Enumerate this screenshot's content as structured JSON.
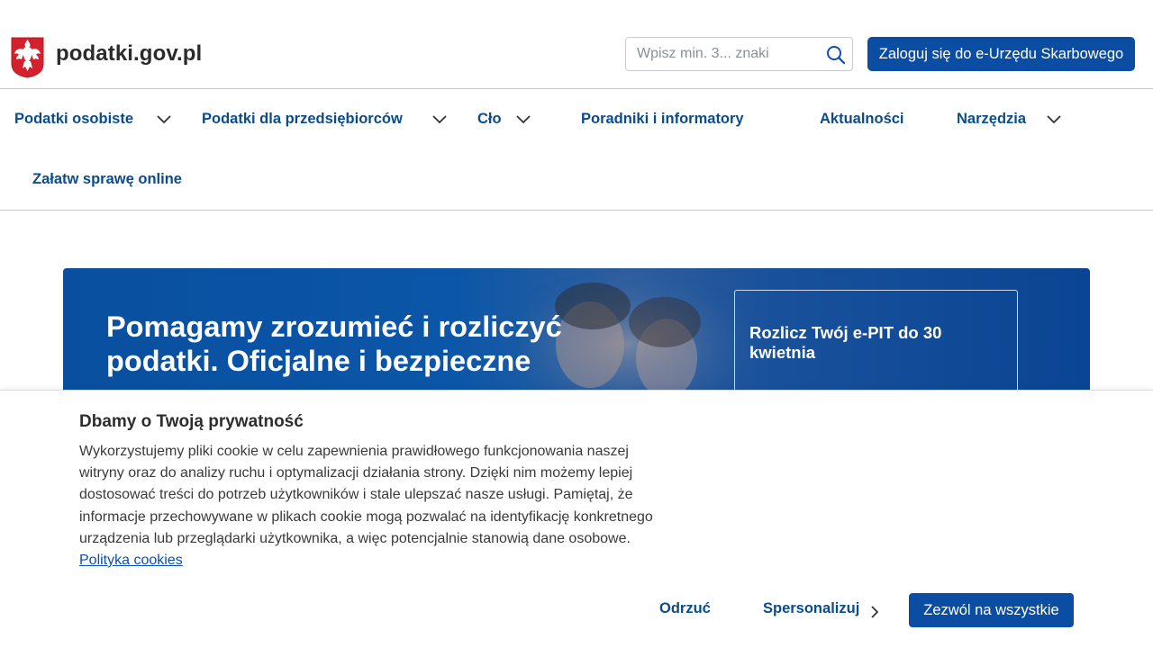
{
  "header": {
    "site_name": "podatki.gov.pl",
    "search_placeholder": "Wpisz min. 3... znaki",
    "login_label": "Zaloguj się do e-Urzędu Skarbowego"
  },
  "nav": {
    "items": [
      {
        "label": "Podatki osobiste",
        "has_dropdown": true
      },
      {
        "label": "Podatki dla przedsiębiorców",
        "has_dropdown": true
      },
      {
        "label": "Cło",
        "has_dropdown": true
      },
      {
        "label": "Poradniki i informatory",
        "has_dropdown": false
      },
      {
        "label": "Aktualności",
        "has_dropdown": false
      },
      {
        "label": "Narzędzia",
        "has_dropdown": true
      },
      {
        "label": "Załatw sprawę online",
        "has_dropdown": false
      }
    ]
  },
  "hero": {
    "title": "Pomagamy zrozumieć i rozliczyć podatki. Oficjalne i bezpieczne",
    "card_title": "Rozlicz Twój e-PIT do 30 kwietnia"
  },
  "cookie": {
    "title": "Dbamy o Twoją prywatność",
    "text": "Wykorzystujemy pliki cookie w celu zapewnienia prawidłowego funkcjonowania naszej witryny oraz do analizy ruchu i optymalizacji działania strony. Dzięki nim możemy lepiej dostosować treści do potrzeb użytkowników i stale ulepszać nasze usługi. Pamiętaj, że informacje przechowywane w plikach cookie mogą pozwalać na identyfikację konkretnego urządzenia lub przeglądarki użytkownika, a więc potencjalnie stanowią dane osobowe.",
    "link_label": "Polityka cookies",
    "reject_label": "Odrzuć",
    "personalize_label": "Spersonalizuj",
    "accept_label": "Zezwól na wszystkie"
  },
  "colors": {
    "primary": "#0a4da2",
    "nav_text": "#0b4c8c",
    "link": "#0b4fb0"
  },
  "icons": {
    "logo": "polish-eagle-icon",
    "search": "search-icon",
    "dropdown": "chevron-down-icon",
    "personalize": "chevron-right-icon"
  }
}
